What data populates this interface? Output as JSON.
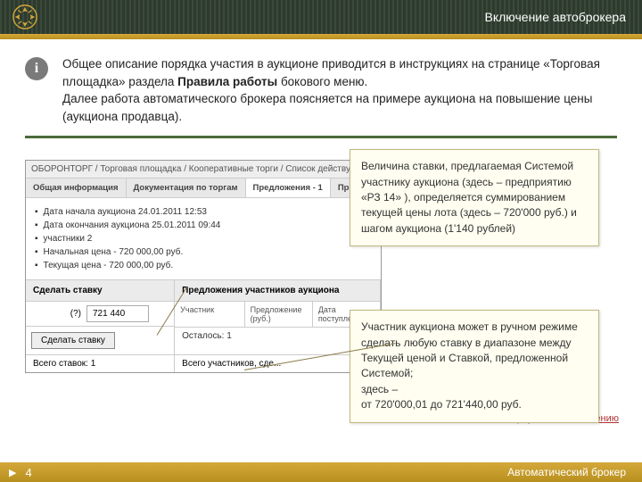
{
  "header": {
    "title": "Включение автоброкера"
  },
  "info": {
    "icon_glyph": "i",
    "para1_a": "Общее описание порядка участия в аукционе приводится в инструкциях на странице «Торговая площадка» раздела ",
    "para1_bold": "Правила работы",
    "para1_b": " бокового меню.",
    "para2": "Далее работа автоматического брокера поясняется на примере аукциона на повышение цены (аукциона продавца)."
  },
  "mock": {
    "breadcrumb": "ОБОРОНТОРГ / Торговая площадка / Кооперативные торги / Список действующих аукцио...",
    "tabs": [
      "Общая информация",
      "Документация по торгам",
      "Предложения - 1",
      "Прото..."
    ],
    "bullets": [
      "Дата начала аукциона 24.01.2011 12:53",
      "Дата окончания аукциона 25.01.2011 09:44",
      "участники    2",
      "Начальная цена - 720 000,00 руб.",
      "Текущая цена - 720 000,00 руб."
    ],
    "section_make_bid": "Сделать ставку",
    "section_offers": "Предложения участников аукциона",
    "bid_q": "(?)",
    "bid_value": "721 440",
    "make_bid_btn": "Сделать ставку",
    "col_participant": "Участник",
    "col_offer": "Предложение (руб.)",
    "col_date": "Дата поступления",
    "remaining": "Осталось: 1",
    "your_bids": "Всего ставок: 1",
    "total_participants": "Всего участников, сде..."
  },
  "callout1": "Величина ставки, предлагаемая Системой участнику аукциона (здесь – предприятию «РЗ 14» ), определяется суммированием текущей цены лота (здесь – 720'000 руб.) и шагом аукциона (1'140 рублей)",
  "callout2_a": "Участник аукциона может в ручном режиме сделать любую ставку в диапазоне между Текущей ценой и Ставкой, предложенной Системой;",
  "callout2_b": "здесь –",
  "callout2_c": "от 720'000,01 до 721'440,00 руб.",
  "footer": {
    "return_link": "Вернуться к Оглавлению",
    "page": "4",
    "label": "Автоматический брокер"
  }
}
